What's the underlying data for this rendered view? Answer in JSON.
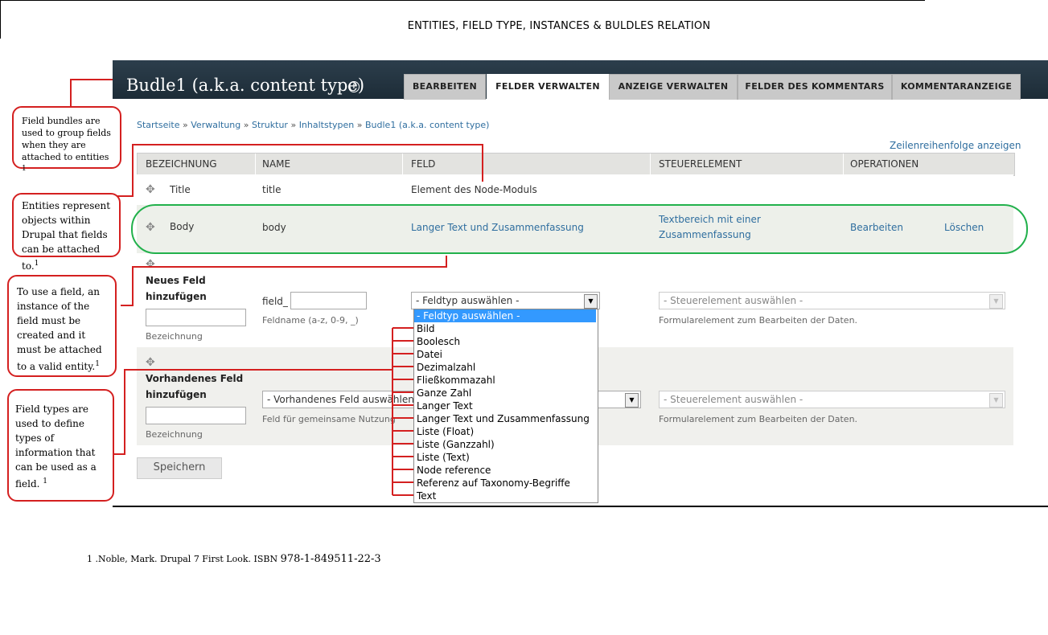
{
  "doc_title": "ENTITIES, FIELD TYPE, INSTANCES & BULDLES RELATION",
  "site_title": "Budle1 (a.k.a. content type)",
  "tabs": [
    {
      "label": "BEARBEITEN",
      "active": false
    },
    {
      "label": "FELDER VERWALTEN",
      "active": true
    },
    {
      "label": "ANZEIGE VERWALTEN",
      "active": false
    },
    {
      "label": "FELDER DES KOMMENTARS",
      "active": false
    },
    {
      "label": "KOMMENTARANZEIGE",
      "active": false
    }
  ],
  "breadcrumb": [
    "Startseite",
    "Verwaltung",
    "Struktur",
    "Inhaltstypen",
    "Budle1 (a.k.a. content type)"
  ],
  "breadcrumb_sep": "»",
  "row_weights_link": "Zeilenreihenfolge anzeigen",
  "table": {
    "headers": [
      "BEZEICHNUNG",
      "NAME",
      "FELD",
      "STEUERELEMENT",
      "OPERATIONEN"
    ],
    "rows": [
      {
        "label": "Title",
        "name": "title",
        "field": "Element des Node-Moduls"
      },
      {
        "label": "Body",
        "name": "body",
        "field": "Langer Text und Zusammenfassung",
        "widget_line1": "Textbereich mit einer",
        "widget_line2": "Zusammenfassung",
        "edit": "Bearbeiten",
        "delete": "Löschen"
      }
    ]
  },
  "new_field": {
    "heading_line1": "Neues Feld",
    "heading_line2": "hinzufügen",
    "label_desc": "Bezeichnung",
    "name_prefix": "field_",
    "name_desc": "Feldname (a-z, 0-9, _)",
    "type_select": "- Feldtyp auswählen -",
    "widget_select": "- Steuerelement auswählen -",
    "widget_desc": "Formularelement zum Bearbeiten der Daten."
  },
  "existing_field": {
    "heading_line1": "Vorhandenes Feld",
    "heading_line2": "hinzufügen",
    "label_desc": "Bezeichnung",
    "field_select": "- Vorhandenes Feld auswählen -",
    "field_desc": "Feld für gemeinsame Nutzung",
    "widget_select": "- Steuerelement auswählen -",
    "widget_desc": "Formularelement zum Bearbeiten der Daten."
  },
  "dropdown_options": [
    "- Feldtyp auswählen -",
    "Bild",
    "Boolesch",
    "Datei",
    "Dezimalzahl",
    "Fließkommazahl",
    "Ganze Zahl",
    "Langer Text",
    "Langer Text und Zusammenfassung",
    "Liste (Float)",
    "Liste (Ganzzahl)",
    "Liste (Text)",
    "Node reference",
    "Referenz auf Taxonomy-Begriffe",
    "Text"
  ],
  "save_button": "Speichern",
  "callouts": {
    "bundles": "Field bundles are used to group fields when they are attached to entities",
    "entities": "Entities represent objects within Drupal that fields can be attached to.",
    "instances": "To use a field, an instance of the field must be created and it must be attached to a valid entity.",
    "types": "Field types are used to define types of information that can be used as a field.",
    "sup": "1"
  },
  "footnote": {
    "text": "1 .Noble, Mark. Drupal 7 First Look. ISBN ",
    "isbn": "978-1-849511-22-3"
  },
  "colors": {
    "header_bg": "#1d2c37",
    "link": "#2f6e9f",
    "callout_border": "#d42020",
    "highlight_oval": "#22b14c",
    "dropdown_selected": "#3399ff"
  }
}
